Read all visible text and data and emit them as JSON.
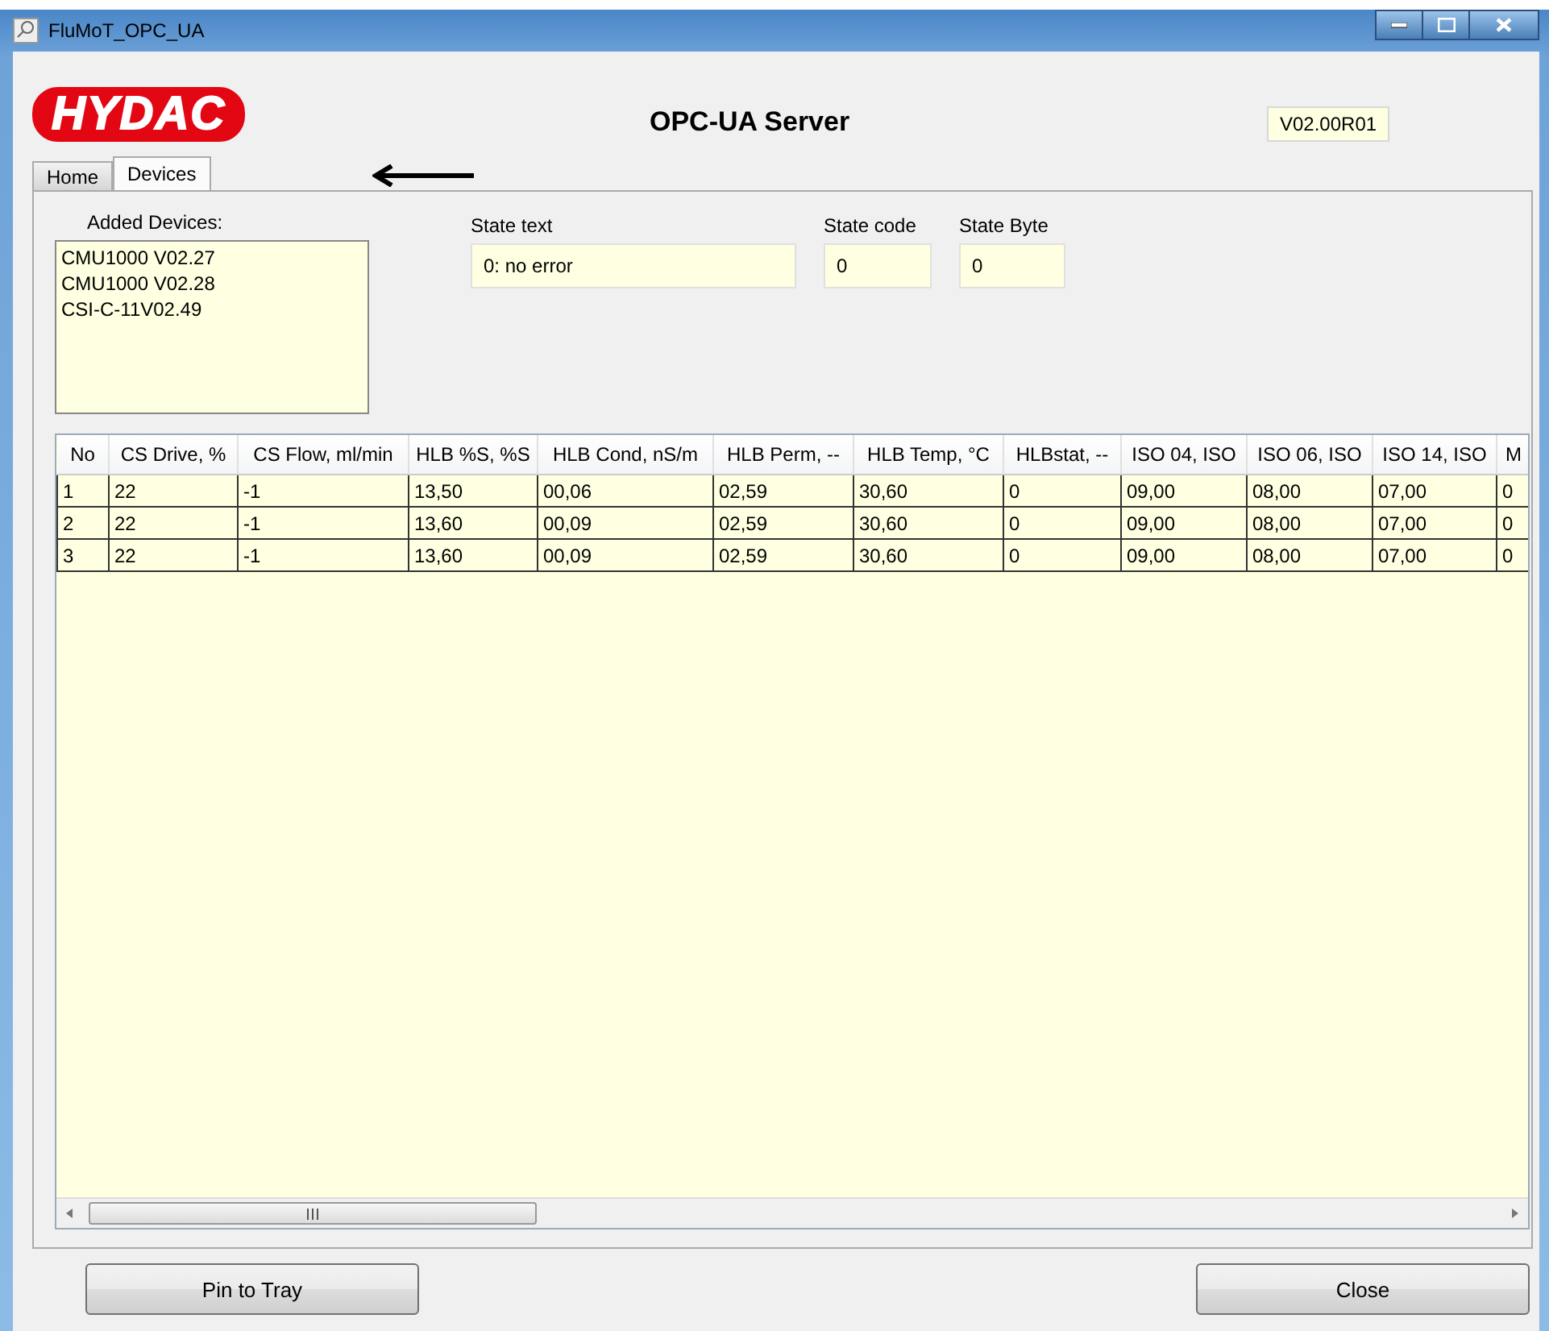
{
  "window": {
    "title": "FluMoT_OPC_UA"
  },
  "header": {
    "logo": "HYDAC",
    "title": "OPC-UA Server",
    "version": "V02.00R01"
  },
  "tabs": [
    {
      "label": "Home",
      "selected": false
    },
    {
      "label": "Devices",
      "selected": true
    }
  ],
  "devices": {
    "label": "Added Devices:",
    "items": [
      "CMU1000 V02.27",
      "CMU1000 V02.28",
      "CSI-C-11V02.49"
    ]
  },
  "state_fields": [
    {
      "label": "State text",
      "value": "0: no error"
    },
    {
      "label": "State code",
      "value": "0"
    },
    {
      "label": "State Byte",
      "value": "0"
    }
  ],
  "table": {
    "columns": [
      "No",
      "CS Drive, %",
      "CS Flow, ml/min",
      "HLB %S, %S",
      "HLB Cond, nS/m",
      "HLB Perm, --",
      "HLB Temp, °C",
      "HLBstat, --",
      "ISO 04, ISO",
      "ISO 06, ISO",
      "ISO 14, ISO",
      "M"
    ],
    "rows": [
      [
        "1",
        "22",
        "-1",
        "13,50",
        "00,06",
        "02,59",
        "30,60",
        "0",
        "09,00",
        "08,00",
        "07,00",
        "0"
      ],
      [
        "2",
        "22",
        "-1",
        "13,60",
        "00,09",
        "02,59",
        "30,60",
        "0",
        "09,00",
        "08,00",
        "07,00",
        "0"
      ],
      [
        "3",
        "22",
        "-1",
        "13,60",
        "00,09",
        "02,59",
        "30,60",
        "0",
        "09,00",
        "08,00",
        "07,00",
        "0"
      ]
    ]
  },
  "buttons": [
    "Pin to Tray",
    "Close"
  ]
}
